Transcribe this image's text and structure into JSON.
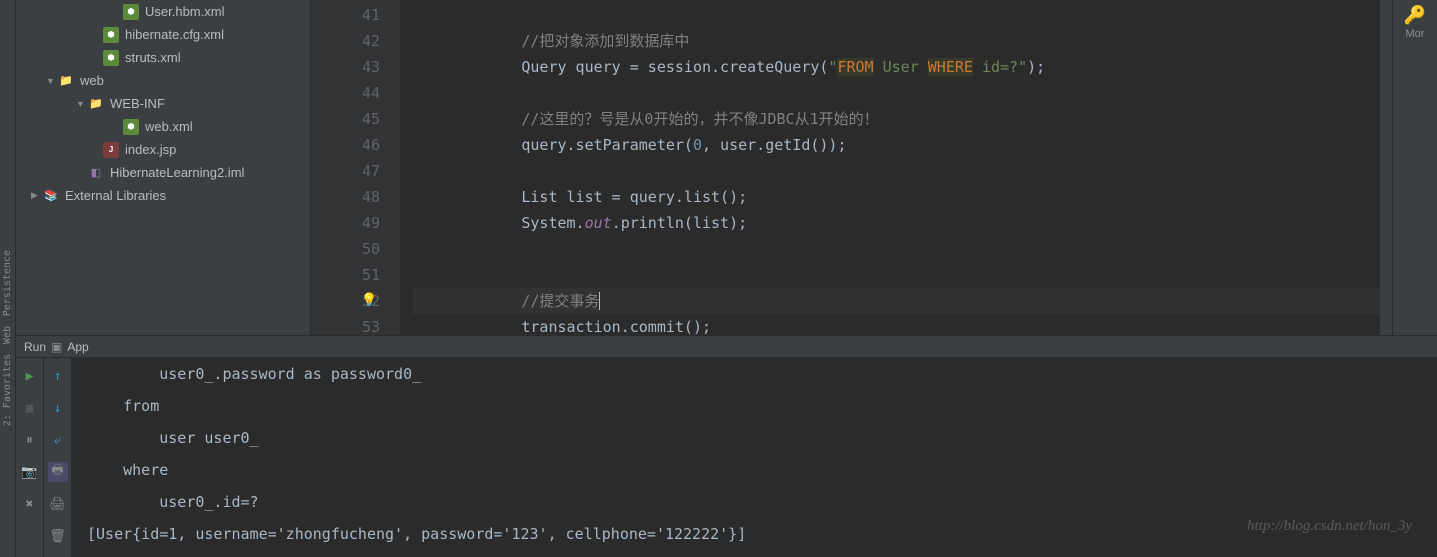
{
  "project_tree": {
    "items": [
      {
        "label": "User.hbm.xml",
        "icon": "xml",
        "indent": "indent-4",
        "arrow": ""
      },
      {
        "label": "hibernate.cfg.xml",
        "icon": "xml",
        "indent": "indent-3",
        "arrow": ""
      },
      {
        "label": "struts.xml",
        "icon": "xml",
        "indent": "indent-3",
        "arrow": ""
      },
      {
        "label": "web",
        "icon": "folder",
        "indent": "indent-00",
        "arrow": "▼"
      },
      {
        "label": "WEB-INF",
        "icon": "folder",
        "indent": "indent-1",
        "arrow": "▼"
      },
      {
        "label": "web.xml",
        "icon": "xml",
        "indent": "indent-4",
        "arrow": ""
      },
      {
        "label": "index.jsp",
        "icon": "jsp",
        "indent": "indent-3",
        "arrow": ""
      },
      {
        "label": "HibernateLearning2.iml",
        "icon": "iml",
        "indent": "indent-1",
        "arrow": ""
      },
      {
        "label": "External Libraries",
        "icon": "lib",
        "indent": "indent-0",
        "arrow": "▶"
      }
    ]
  },
  "left_sidebar": {
    "persistence": "Persistence",
    "web": "Web",
    "favorites": "2: Favorites"
  },
  "right_sidebar": {
    "label": "Mor"
  },
  "editor": {
    "lines": [
      {
        "num": "41",
        "tokens": []
      },
      {
        "num": "42",
        "tokens": [
          {
            "cls": "comment",
            "t": "            //把对象添加到数据库中"
          }
        ]
      },
      {
        "num": "43",
        "tokens": [
          {
            "cls": "",
            "t": "            Query query = session.createQuery("
          },
          {
            "cls": "string",
            "t": "\""
          },
          {
            "cls": "string-highlight",
            "t": "FROM"
          },
          {
            "cls": "string",
            "t": " User "
          },
          {
            "cls": "string-highlight",
            "t": "WHERE"
          },
          {
            "cls": "string",
            "t": " id=?\""
          },
          {
            "cls": "",
            "t": ");"
          }
        ]
      },
      {
        "num": "44",
        "tokens": []
      },
      {
        "num": "45",
        "tokens": [
          {
            "cls": "comment",
            "t": "            //这里的？号是从0开始的，并不像JDBC从1开始的！"
          }
        ]
      },
      {
        "num": "46",
        "tokens": [
          {
            "cls": "",
            "t": "            query.setParameter("
          },
          {
            "cls": "number",
            "t": "0"
          },
          {
            "cls": "",
            "t": ", user.getId());"
          }
        ]
      },
      {
        "num": "47",
        "tokens": []
      },
      {
        "num": "48",
        "tokens": [
          {
            "cls": "",
            "t": "            List list = query.list();"
          }
        ]
      },
      {
        "num": "49",
        "tokens": [
          {
            "cls": "",
            "t": "            System."
          },
          {
            "cls": "static-field",
            "t": "out"
          },
          {
            "cls": "",
            "t": ".println(list);"
          }
        ]
      },
      {
        "num": "50",
        "tokens": []
      },
      {
        "num": "51",
        "tokens": []
      },
      {
        "num": "52",
        "tokens": [
          {
            "cls": "comment",
            "t": "            //提交事务"
          }
        ],
        "current": true,
        "bulb": true
      },
      {
        "num": "53",
        "tokens": [
          {
            "cls": "",
            "t": "            transaction.commit();"
          }
        ]
      }
    ]
  },
  "run_bar": {
    "run_label": "Run",
    "app_label": "App"
  },
  "console": {
    "lines": [
      "        user0_.password as password0_ ",
      "    from",
      "        user user0_ ",
      "    where",
      "        user0_.id=?",
      "[User{id=1, username='zhongfucheng', password='123', cellphone='122222'}]"
    ]
  },
  "watermark": "http://blog.csdn.net/hon_3y"
}
